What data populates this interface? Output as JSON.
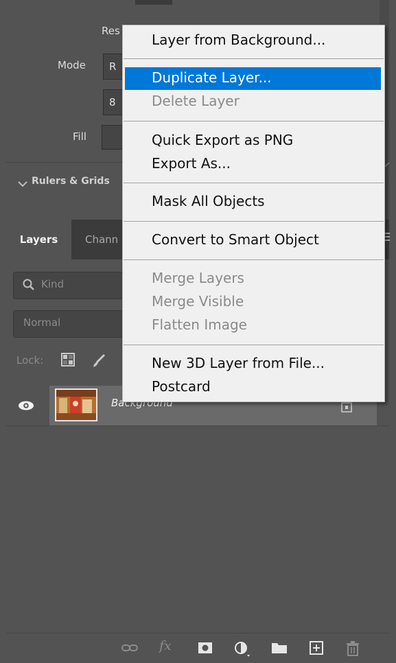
{
  "properties": {
    "resolution_label": "Res",
    "mode_label": "Mode",
    "mode_value": "R",
    "depth_value": "8",
    "fill_label": "Fill",
    "section_title": "Rulers & Grids"
  },
  "tabs": [
    {
      "label": "Layers",
      "active": true
    },
    {
      "label": "Chann",
      "active": false
    }
  ],
  "layers_panel": {
    "filter_placeholder": "Kind",
    "blend_mode": "Normal",
    "lock_label": "Lock:",
    "layers": [
      {
        "name": "Background",
        "visible": true,
        "locked": true
      }
    ]
  },
  "context_menu": {
    "highlight_color": "#0078d7",
    "items": [
      {
        "label": "Layer from Background...",
        "enabled": true
      },
      {
        "label": "Duplicate Layer...",
        "enabled": true,
        "highlighted": true
      },
      {
        "label": "Delete Layer",
        "enabled": false
      },
      {
        "label": "Quick Export as PNG",
        "enabled": true
      },
      {
        "label": "Export As...",
        "enabled": true
      },
      {
        "label": "Mask All Objects",
        "enabled": true
      },
      {
        "label": "Convert to Smart Object",
        "enabled": true
      },
      {
        "label": "Merge Layers",
        "enabled": false
      },
      {
        "label": "Merge Visible",
        "enabled": false
      },
      {
        "label": "Flatten Image",
        "enabled": false
      },
      {
        "label": "New 3D Layer from File...",
        "enabled": true
      },
      {
        "label": "Postcard",
        "enabled": true
      }
    ]
  },
  "toolbar_icons": [
    "link-layers-icon",
    "fx-icon",
    "add-mask-icon",
    "adjustment-layer-icon",
    "new-group-icon",
    "new-layer-icon",
    "delete-layer-icon"
  ],
  "toolbar": {
    "fx_label": "fx"
  }
}
